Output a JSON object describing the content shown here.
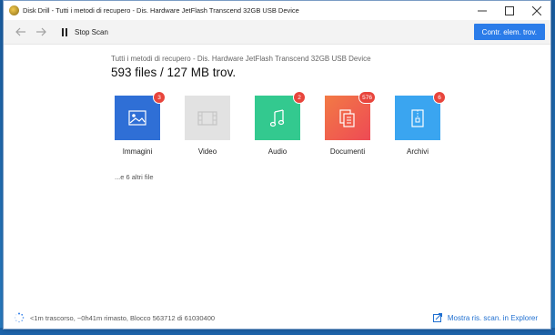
{
  "window": {
    "title": "Disk Drill - Tutti i metodi di recupero - Dis. Hardware JetFlash Transcend 32GB USB Device"
  },
  "toolbar": {
    "stop_label": "Stop Scan",
    "review_label": "Contr. elem. trov."
  },
  "main": {
    "subtitle": "Tutti i metodi di recupero - Dis. Hardware JetFlash Transcend 32GB USB Device",
    "headline": "593 files / 127 MB trov.",
    "more_files": "...e 6 altri file"
  },
  "categories": [
    {
      "label": "Immagini",
      "badge": "3",
      "color": "#2f6fd6",
      "icon": "image-icon"
    },
    {
      "label": "Video",
      "badge": "",
      "color": "#e2e2e2",
      "icon": "film-icon"
    },
    {
      "label": "Audio",
      "badge": "2",
      "color": "#33c98f",
      "icon": "music-note-icon"
    },
    {
      "label": "Documenti",
      "badge": "576",
      "color": "#f05c4a",
      "icon": "document-icon"
    },
    {
      "label": "Archivi",
      "badge": "6",
      "color": "#3aa5f0",
      "icon": "archive-icon"
    }
  ],
  "status": {
    "text": "<1m trascorso, ~0h41m rimasto, Blocco 563712 di 61030400",
    "explorer_label": "Mostra ris. scan. in Explorer"
  }
}
